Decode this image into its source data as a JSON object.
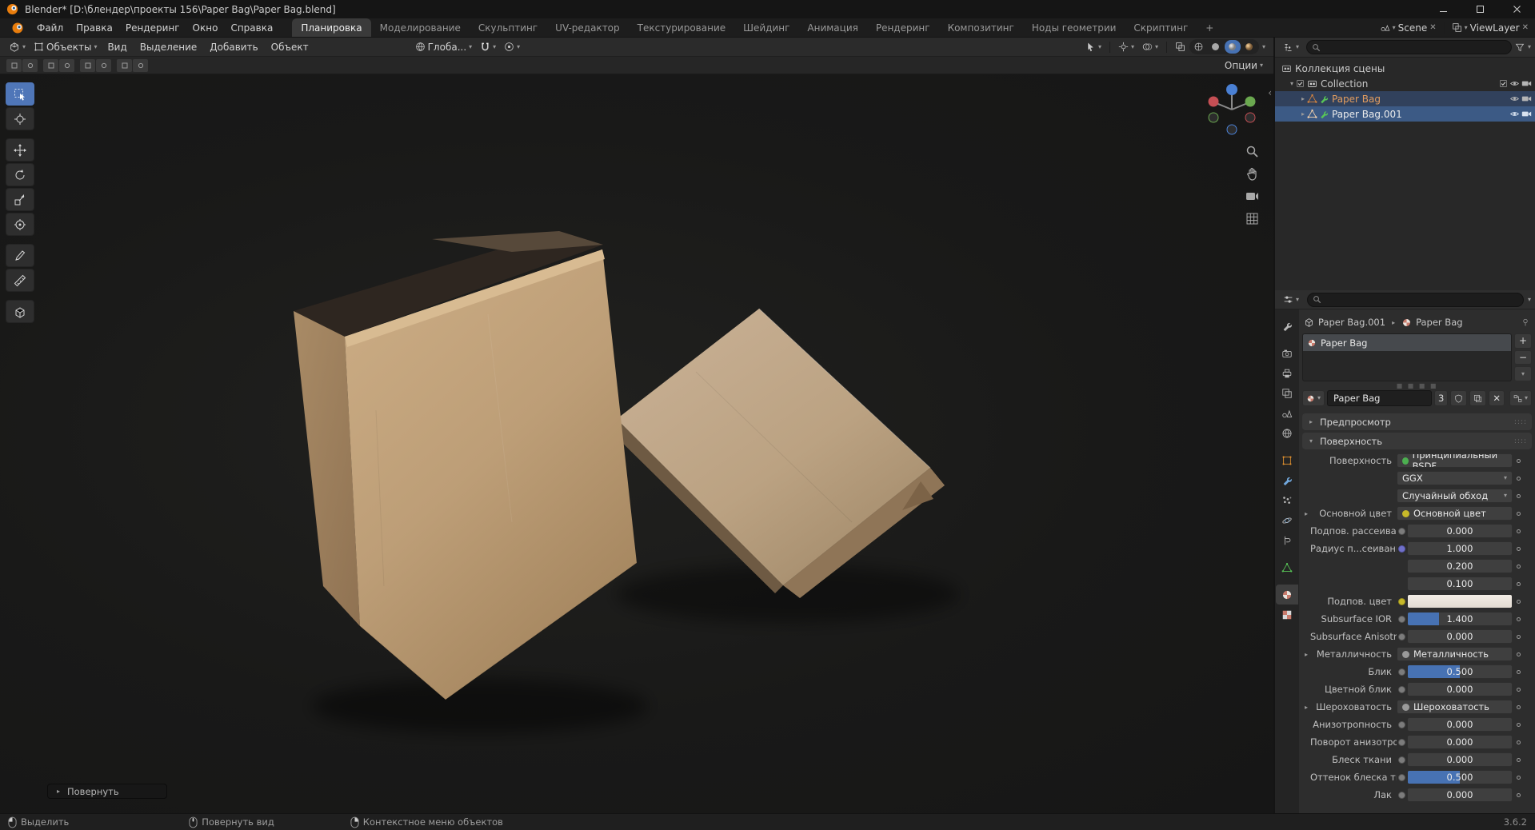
{
  "window": {
    "title": "Blender* [D:\\блендер\\проекты 156\\Paper Bag\\Paper Bag.blend]",
    "controls": [
      "minimize-icon",
      "maximize-icon",
      "close-icon"
    ]
  },
  "topbar": {
    "menus": [
      "Файл",
      "Правка",
      "Рендеринг",
      "Окно",
      "Справка"
    ],
    "tabs": [
      "Планировка",
      "Моделирование",
      "Скульптинг",
      "UV-редактор",
      "Текстурирование",
      "Шейдинг",
      "Анимация",
      "Рендеринг",
      "Композитинг",
      "Ноды геометрии",
      "Скриптинг"
    ],
    "active_tab": "Планировка",
    "add_tab": "+",
    "scene_label": "Scene",
    "viewlayer_label": "ViewLayer"
  },
  "viewport": {
    "header": {
      "mode": "Объекты",
      "menus": [
        "Вид",
        "Выделение",
        "Добавить",
        "Объект"
      ],
      "orientation": "Глоба...",
      "options": "Опции"
    },
    "operator_panel": "Повернуть",
    "toolbar_icons": [
      "select-box",
      "cursor",
      "move",
      "rotate",
      "scale",
      "transform",
      "annotate",
      "measure",
      "add-cube"
    ],
    "nav_icons": [
      "zoom",
      "pan-hand",
      "camera-view",
      "toggle-perspective"
    ]
  },
  "outliner": {
    "rows": [
      {
        "label": "Коллекция сцены"
      },
      {
        "label": "Collection"
      },
      {
        "label": "Paper Bag"
      },
      {
        "label": "Paper Bag.001"
      }
    ]
  },
  "properties": {
    "breadcrumb": {
      "object": "Paper Bag.001",
      "material": "Paper Bag"
    },
    "slot": {
      "name": "Paper Bag"
    },
    "datablock": {
      "name": "Paper Bag",
      "users": "3"
    },
    "panels": {
      "preview": "Предпросмотр",
      "surface": "Поверхность"
    },
    "surface": {
      "surface_label": "Поверхность",
      "surface_value": "Принципиальный BSDF",
      "distribution": "GGX",
      "subsurface_method": "Случайный обход",
      "base_color_label": "Основной цвет",
      "base_color_value": "Основной цвет",
      "subsurface_label": "Подпов. рассеива...",
      "subsurface_value": "0.000",
      "radius_label": "Радиус п...сеивания",
      "radius_values": [
        "1.000",
        "0.200",
        "0.100"
      ],
      "subsurface_color_label": "Подпов. цвет",
      "ior_label": "Subsurface IOR",
      "ior_value": "1.400",
      "aniso_label": "Subsurface Anisotr...",
      "aniso_value": "0.000",
      "metallic_label": "Металличность",
      "metallic_value": "Металличность",
      "specular_label": "Блик",
      "specular_value": "0.500",
      "specular_tint_label": "Цветной блик",
      "specular_tint_value": "0.000",
      "roughness_label": "Шероховатость",
      "roughness_value": "Шероховатость",
      "anisotropic_label": "Анизотропность",
      "anisotropic_value": "0.000",
      "aniso_rotation_label": "Поворот анизотро...",
      "aniso_rotation_value": "0.000",
      "sheen_label": "Блеск ткани",
      "sheen_value": "0.000",
      "sheen_tint_label": "Оттенок блеска тк...",
      "sheen_tint_value": "0.500",
      "clearcoat_label": "Лак",
      "clearcoat_value": "0.000"
    },
    "fills": {
      "ior": 30,
      "specular": 50,
      "sheen_tint": 50,
      "zero": 0
    }
  },
  "statusbar": {
    "items": [
      "Выделить",
      "Повернуть вид",
      "Контекстное меню объектов"
    ],
    "version": "3.6.2"
  },
  "colors": {
    "accent": "#4772b3",
    "kraft": "#bd9e77",
    "selection_blue": "#3c5a85",
    "active_object_orange": "#e39d5f"
  }
}
